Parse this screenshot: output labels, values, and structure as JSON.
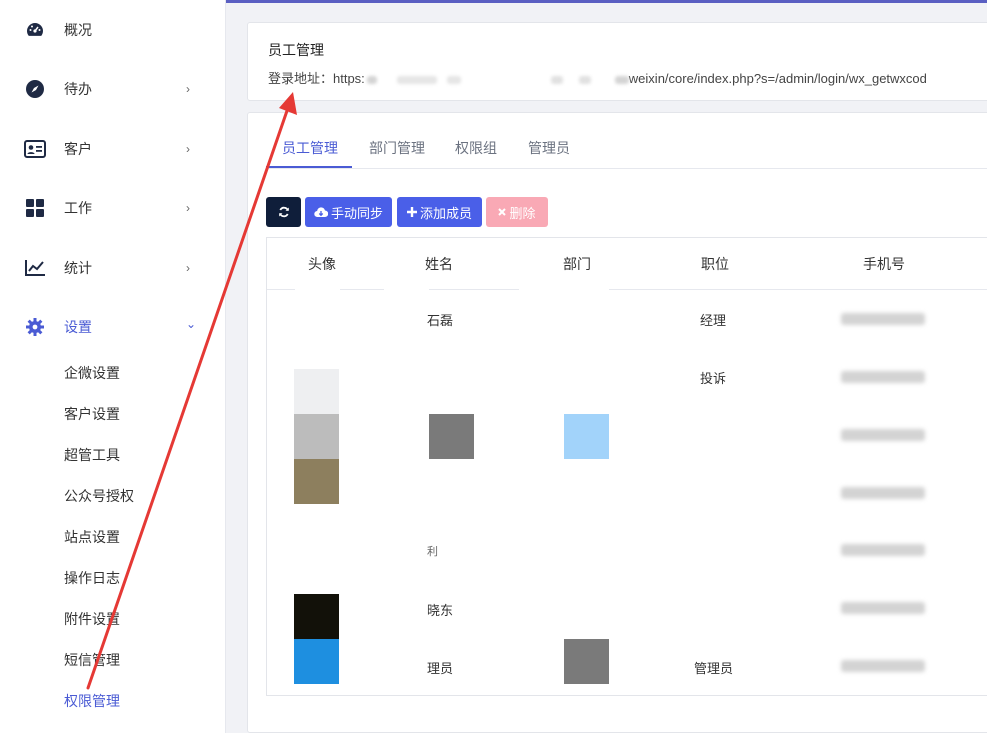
{
  "sidebar": {
    "items": [
      {
        "label": "概况",
        "icon": "dashboard-icon",
        "has_chevron": false
      },
      {
        "label": "待办",
        "icon": "compass-icon",
        "has_chevron": true
      },
      {
        "label": "客户",
        "icon": "id-card-icon",
        "has_chevron": true
      },
      {
        "label": "工作",
        "icon": "grid-icon",
        "has_chevron": true
      },
      {
        "label": "统计",
        "icon": "chart-line-icon",
        "has_chevron": true
      },
      {
        "label": "设置",
        "icon": "gear-icon",
        "has_chevron": true,
        "expanded": true
      }
    ],
    "submenu": [
      {
        "label": "企微设置"
      },
      {
        "label": "客户设置"
      },
      {
        "label": "超管工具"
      },
      {
        "label": "公众号授权"
      },
      {
        "label": "站点设置"
      },
      {
        "label": "操作日志"
      },
      {
        "label": "附件设置"
      },
      {
        "label": "短信管理"
      },
      {
        "label": "权限管理",
        "active": true
      }
    ],
    "chevron_right": "›",
    "chevron_down": "⌄"
  },
  "header": {
    "title": "员工管理",
    "url_prefix": "登录地址：https:",
    "url_suffix": "weixin/core/index.php?s=/admin/login/wx_getwxcod"
  },
  "tabs": [
    {
      "label": "员工管理",
      "active": true
    },
    {
      "label": "部门管理"
    },
    {
      "label": "权限组"
    },
    {
      "label": "管理员"
    }
  ],
  "toolbar": {
    "refresh_icon": "refresh-icon",
    "sync_label": "手动同步",
    "sync_icon": "cloud-download-icon",
    "add_label": "添加成员",
    "add_icon": "plus-icon",
    "delete_label": "删除",
    "delete_icon": "close-icon"
  },
  "table": {
    "headers": [
      "头像",
      "姓名",
      "部门",
      "职位",
      "手机号"
    ],
    "rows": [
      {
        "name": "石磊",
        "position": "经理"
      },
      {
        "name": "",
        "position": "投诉"
      },
      {
        "name": "",
        "position": ""
      },
      {
        "name": "",
        "position": ""
      },
      {
        "name": "利",
        "position": ""
      },
      {
        "name": "晓东",
        "position": ""
      },
      {
        "name": "理员",
        "position": "管理员"
      }
    ]
  },
  "colors": {
    "accent": "#4a5bd4",
    "button_primary": "#4a5fe8",
    "button_dark": "#0f1e3a",
    "button_danger_disabled": "#f9a9b5",
    "annotation_arrow": "#e53935"
  }
}
